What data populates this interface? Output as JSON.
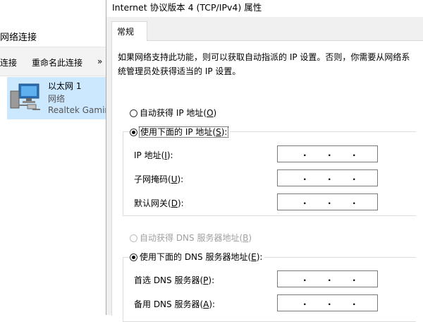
{
  "background_window": {
    "title": "网络连接",
    "toolbar": {
      "item1": "连接",
      "item2": "重命名此连接",
      "more": "»"
    },
    "adapter": {
      "name": "以太网 1",
      "status": "网络",
      "device": "Realtek Gamin"
    }
  },
  "dialog": {
    "title": "Internet 协议版本 4 (TCP/IPv4) 属性",
    "tab": "常规",
    "description": "如果网络支持此功能，则可以获取自动指派的 IP 设置。否则，你需要从网络系统管理员处获得适当的 IP 设置。",
    "ip": {
      "auto_label": "自动获得 IP 地址(",
      "auto_key": "O",
      "manual_label": "使用下面的 IP 地址(",
      "manual_key": "S",
      "fields": [
        {
          "label": "IP 地址(",
          "key": "I",
          "value": ". . ."
        },
        {
          "label": "子网掩码(",
          "key": "U",
          "value": ". . ."
        },
        {
          "label": "默认网关(",
          "key": "D",
          "value": ". . ."
        }
      ]
    },
    "dns": {
      "auto_label": "自动获得 DNS 服务器地址(",
      "auto_key": "B",
      "manual_label": "使用下面的 DNS 服务器地址(",
      "manual_key": "E",
      "fields": [
        {
          "label": "首选 DNS 服务器(",
          "key": "P",
          "value": ". . ."
        },
        {
          "label": "备用 DNS 服务器(",
          "key": "A",
          "value": ". . ."
        }
      ]
    },
    "colors": {
      "selection": "#cce8ff",
      "dialog_bg": "#f0f0f0",
      "disabled_text": "#a0a0a0"
    }
  }
}
